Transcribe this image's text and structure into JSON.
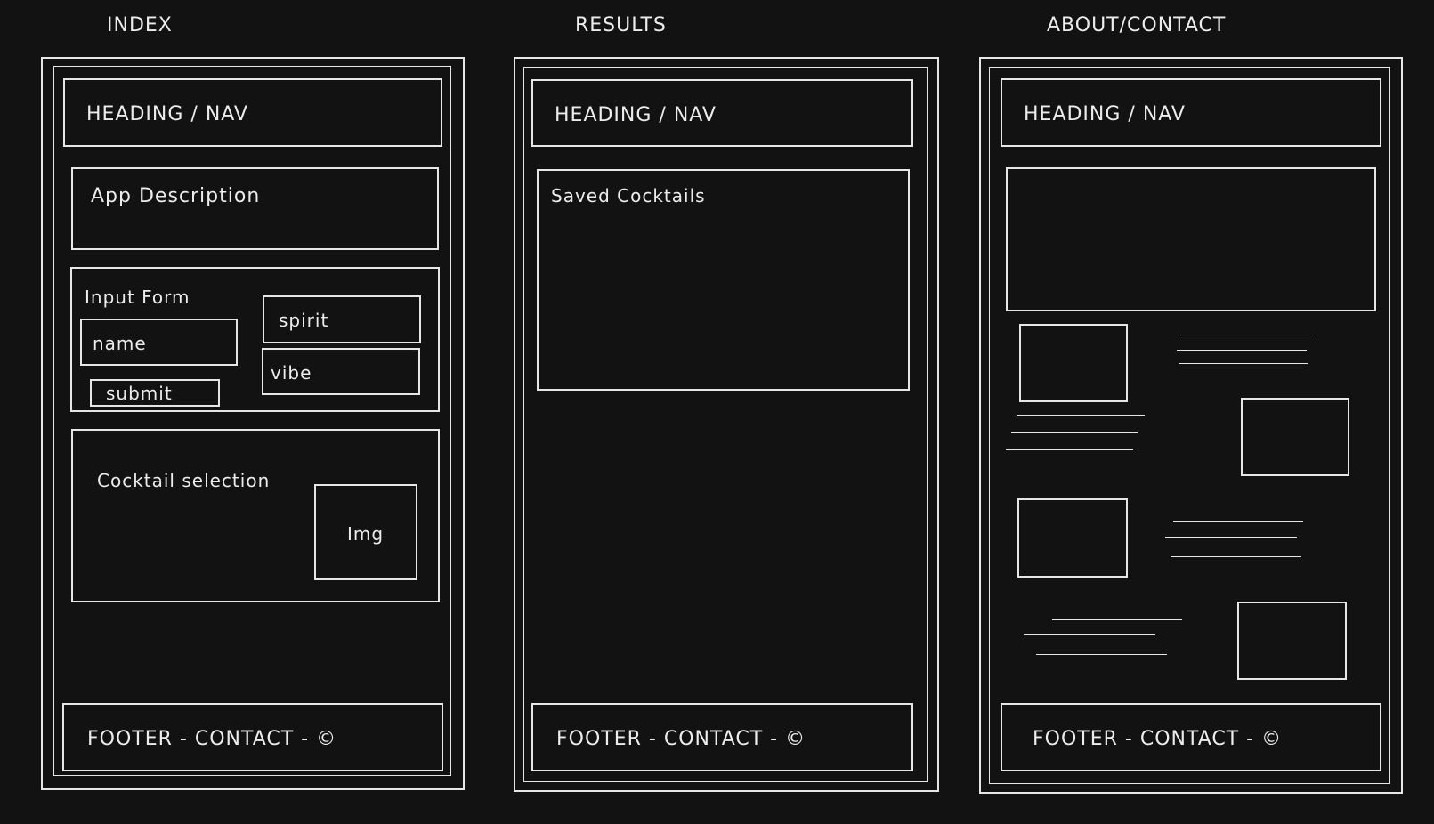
{
  "columns": {
    "index": {
      "title": "INDEX",
      "heading": "HEADING / NAV",
      "description": "App Description",
      "form": {
        "title": "Input Form",
        "name_field": "name",
        "submit_button": "submit",
        "spirit_field": "spirit",
        "vibe_field": "vibe"
      },
      "selection": {
        "title": "Cocktail selection",
        "image": "Img"
      },
      "footer": "FOOTER - CONTACT - ©"
    },
    "results": {
      "title": "RESULTS",
      "heading": "HEADING / NAV",
      "saved": "Saved Cocktails",
      "footer": "FOOTER - CONTACT - ©"
    },
    "about": {
      "title": "ABOUT/CONTACT",
      "heading": "HEADING / NAV",
      "footer": "FOOTER - CONTACT - ©"
    }
  },
  "colors": {
    "background": "#121212",
    "stroke": "#e6e6e6"
  }
}
